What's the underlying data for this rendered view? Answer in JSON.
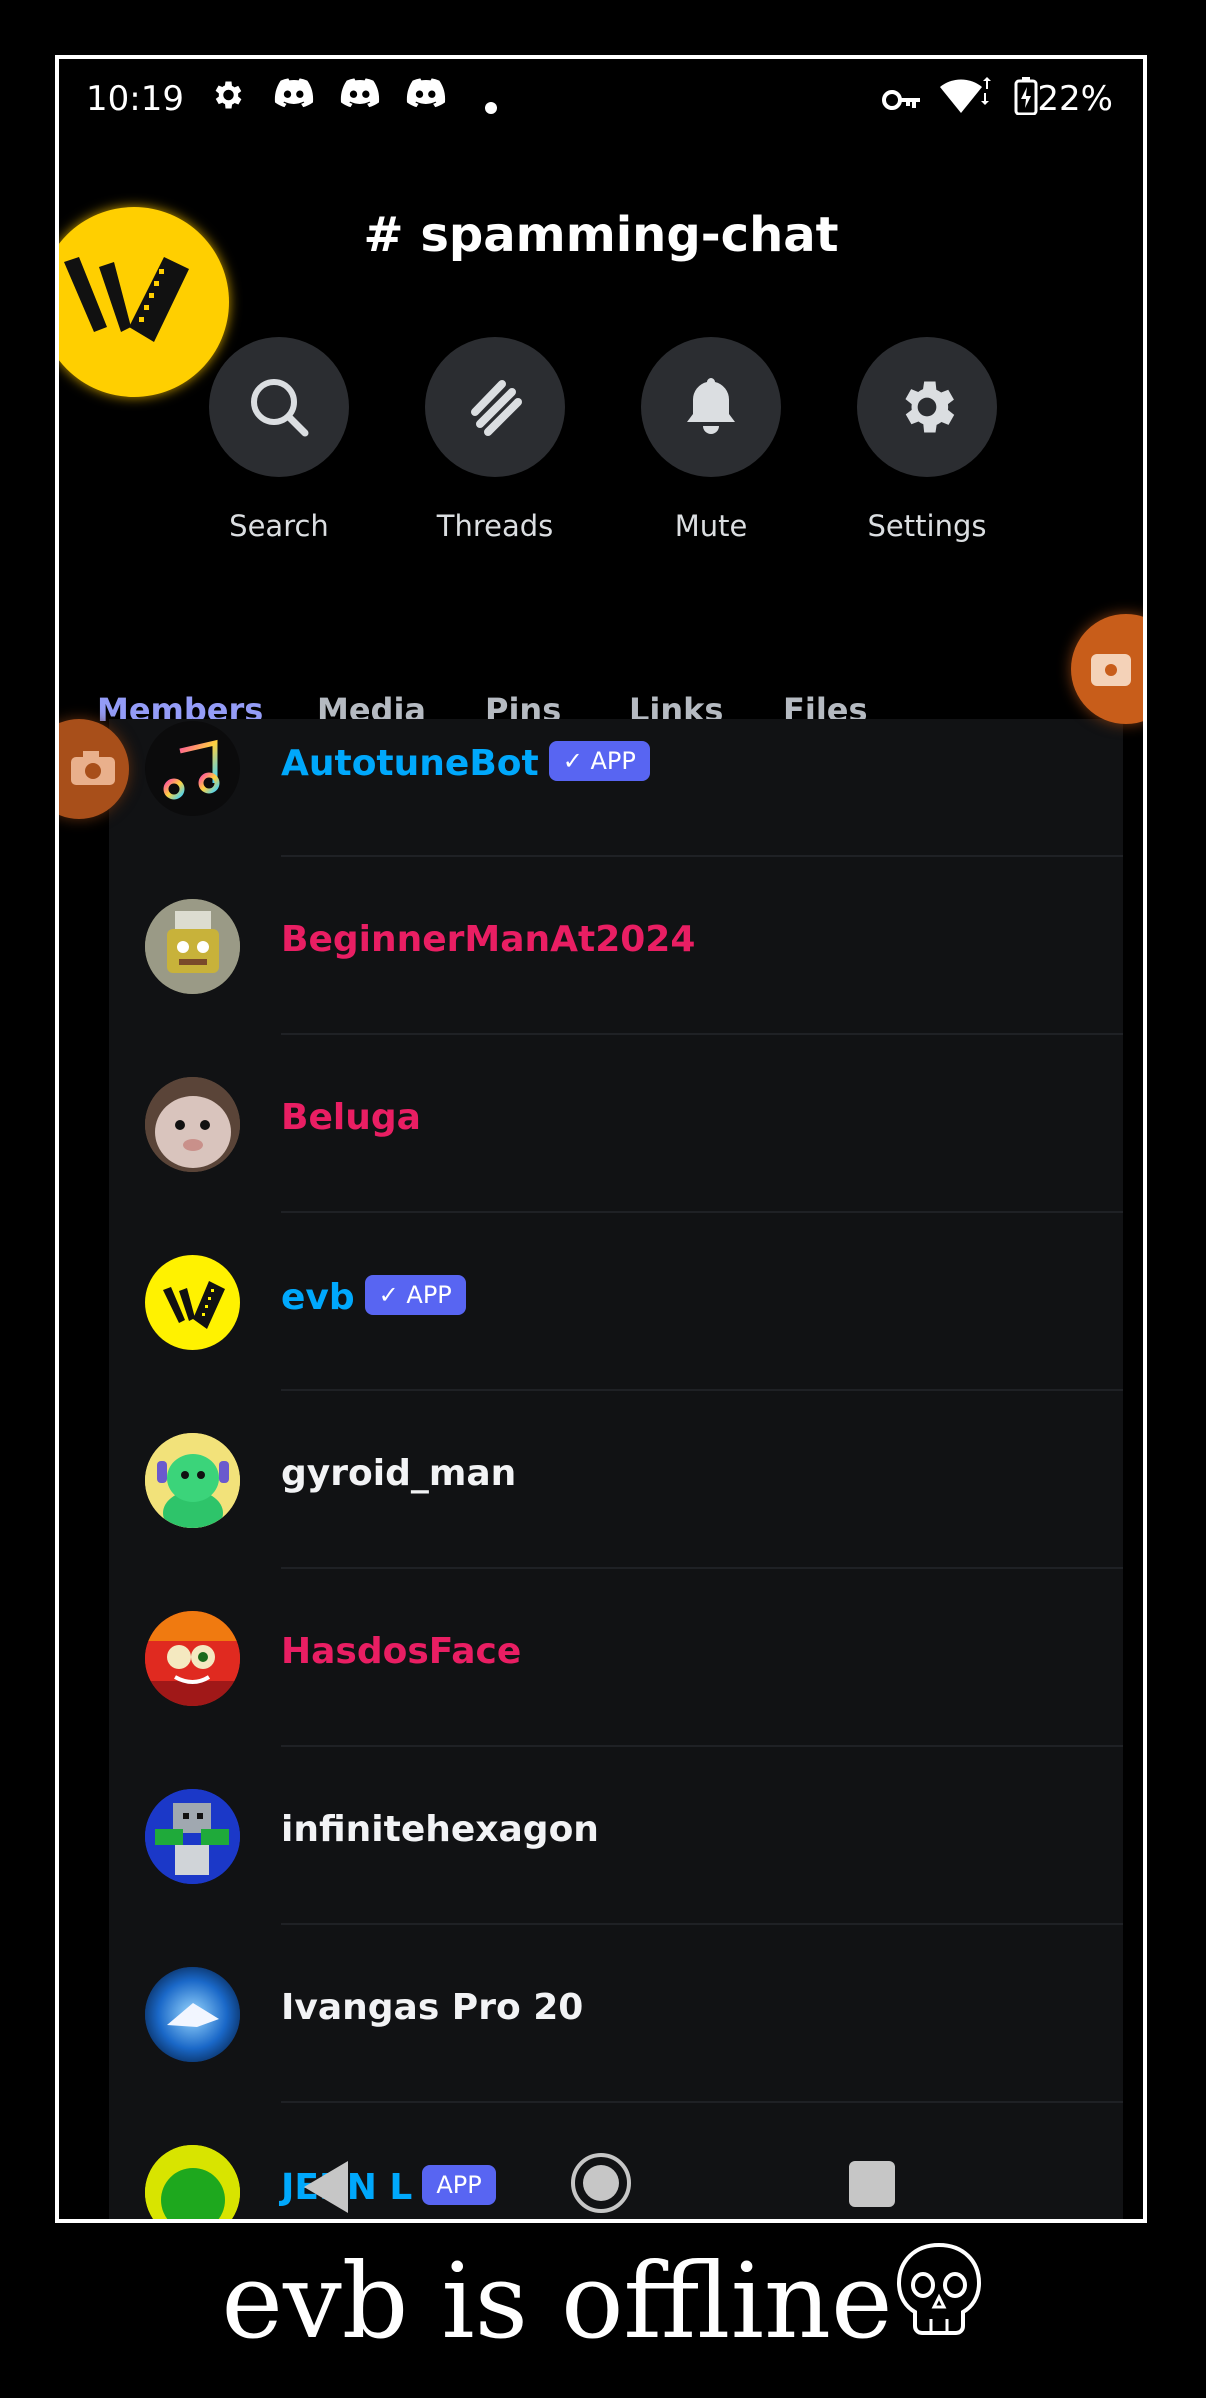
{
  "status_bar": {
    "time": "10:19",
    "battery": "22%",
    "icons": [
      "gear-icon",
      "discord-icon",
      "discord-icon",
      "discord-icon",
      "dot-icon",
      "vpn-key-icon",
      "wifi-icon",
      "battery-charging-icon"
    ]
  },
  "channel": {
    "title": "# spamming-chat"
  },
  "actions": [
    {
      "label": "Search",
      "icon": "search-icon"
    },
    {
      "label": "Threads",
      "icon": "threads-icon"
    },
    {
      "label": "Mute",
      "icon": "bell-icon"
    },
    {
      "label": "Settings",
      "icon": "gear-icon"
    }
  ],
  "tabs": [
    "Members",
    "Media",
    "Pins",
    "Links",
    "Files"
  ],
  "active_tab": "Members",
  "members": [
    {
      "name": "AutotuneBot",
      "color": "#00a8fc",
      "badge": "APP"
    },
    {
      "name": "BeginnerManAt2024",
      "color": "#e91e63",
      "badge": ""
    },
    {
      "name": "Beluga",
      "color": "#e91e63",
      "badge": ""
    },
    {
      "name": "evb",
      "color": "#00a8fc",
      "badge": "APP"
    },
    {
      "name": "gyroid_man",
      "color": "#f2f3f5",
      "badge": ""
    },
    {
      "name": "HasdosFace",
      "color": "#e91e63",
      "badge": ""
    },
    {
      "name": "infinitehexagon",
      "color": "#f2f3f5",
      "badge": ""
    },
    {
      "name": "Ivangas Pro 20",
      "color": "#f2f3f5",
      "badge": ""
    },
    {
      "name": "JERN L",
      "color": "#00a8fc",
      "badge": "APP"
    }
  ],
  "caption": "evb is offline"
}
